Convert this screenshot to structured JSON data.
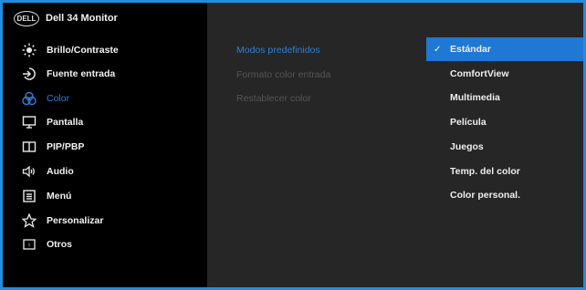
{
  "header": {
    "logo_text": "DELL",
    "model": "Dell 34 Monitor"
  },
  "sidebar": {
    "items": [
      {
        "label": "Brillo/Contraste",
        "icon": "brightness-icon"
      },
      {
        "label": "Fuente entrada",
        "icon": "input-source-icon"
      },
      {
        "label": "Color",
        "icon": "color-palette-icon",
        "active": true
      },
      {
        "label": "Pantalla",
        "icon": "display-icon"
      },
      {
        "label": "PIP/PBP",
        "icon": "pip-pbp-icon"
      },
      {
        "label": "Audio",
        "icon": "audio-icon"
      },
      {
        "label": "Menú",
        "icon": "menu-icon"
      },
      {
        "label": "Personalizar",
        "icon": "star-icon"
      },
      {
        "label": "Otros",
        "icon": "others-icon"
      }
    ]
  },
  "submenu": {
    "items": [
      {
        "label": "Modos predefinidos",
        "active": true
      },
      {
        "label": "Formato color entrada"
      },
      {
        "label": "Restablecer color"
      }
    ]
  },
  "options": {
    "items": [
      {
        "label": "Estándar",
        "selected": true
      },
      {
        "label": "ComfortView"
      },
      {
        "label": "Multimedia"
      },
      {
        "label": "Película"
      },
      {
        "label": "Juegos"
      },
      {
        "label": "Temp. del color"
      },
      {
        "label": "Color personal."
      }
    ],
    "check_glyph": "✓"
  },
  "colors": {
    "accent": "#1e78d4",
    "active_text": "#2f7fd6",
    "frame": "#1e8fe0"
  }
}
